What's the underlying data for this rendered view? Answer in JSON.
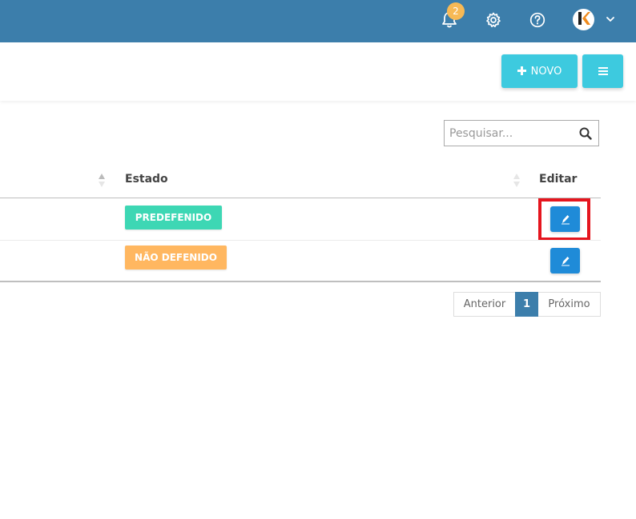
{
  "topbar": {
    "notifications_count": "2",
    "icons": [
      "bell-icon",
      "gear-icon",
      "help-icon",
      "chevron-down-icon"
    ],
    "avatar_letter": "k"
  },
  "toolbar": {
    "new_label": "NOVO",
    "new_icon": "plus-icon",
    "menu_icon": "hamburger-icon"
  },
  "search": {
    "placeholder": "Pesquisar...",
    "value": ""
  },
  "table": {
    "columns": [
      "",
      "Estado",
      "Editar"
    ],
    "rows": [
      {
        "estado": "PREDEFENIDO",
        "estado_color": "#3dd7b4",
        "highlighted": true
      },
      {
        "estado": "NÃO DEFENIDO",
        "estado_color": "#ffb760",
        "highlighted": false
      }
    ]
  },
  "pagination": {
    "prev_label": "Anterior",
    "current_page": "1",
    "next_label": "Próximo"
  },
  "colors": {
    "topbar": "#3c7eab",
    "accent": "#3dcadf",
    "edit_button": "#1f8bd8",
    "highlight": "#e5151e"
  }
}
